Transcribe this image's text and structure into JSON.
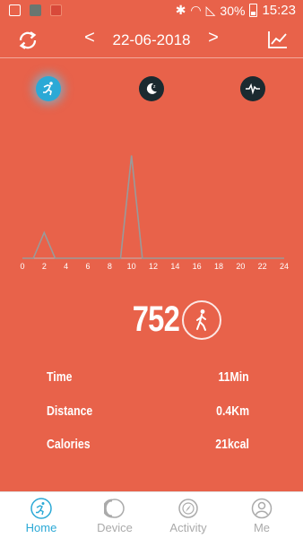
{
  "status_bar": {
    "battery": "30%",
    "time": "15:23"
  },
  "header": {
    "date": "22-06-2018",
    "prev_label": "<",
    "next_label": ">"
  },
  "modes": [
    {
      "name": "activity",
      "icon": "running-icon",
      "active": true
    },
    {
      "name": "sleep",
      "icon": "moon-icon",
      "active": false
    },
    {
      "name": "heart-rate",
      "icon": "heartbeat-icon",
      "active": false
    }
  ],
  "chart_data": {
    "type": "line",
    "x": [
      0,
      1,
      2,
      3,
      4,
      5,
      6,
      7,
      8,
      9,
      10,
      11,
      12,
      13,
      14,
      15,
      16,
      17,
      18,
      19,
      20,
      21,
      22,
      23,
      24
    ],
    "values": [
      0,
      0,
      150,
      0,
      0,
      0,
      0,
      0,
      0,
      0,
      600,
      0,
      0,
      0,
      0,
      0,
      0,
      0,
      0,
      0,
      0,
      0,
      0,
      0,
      0
    ],
    "x_ticks": [
      "0",
      "2",
      "4",
      "6",
      "8",
      "10",
      "12",
      "14",
      "16",
      "18",
      "20",
      "22",
      "24"
    ],
    "xlim": [
      0,
      24
    ],
    "ylim": [
      0,
      650
    ],
    "line_color": "#9a9a9a"
  },
  "summary": {
    "steps": "752",
    "steps_icon": "walking-icon"
  },
  "stats": [
    {
      "label": "Time",
      "value": "11Min"
    },
    {
      "label": "Distance",
      "value": "0.4Km"
    },
    {
      "label": "Calories",
      "value": "21kcal"
    }
  ],
  "tabs": [
    {
      "label": "Home",
      "icon": "running-icon",
      "active": true
    },
    {
      "label": "Device",
      "icon": "watch-icon",
      "active": false
    },
    {
      "label": "Activity",
      "icon": "compass-icon",
      "active": false
    },
    {
      "label": "Me",
      "icon": "user-icon",
      "active": false
    }
  ],
  "colors": {
    "background": "#E8624A",
    "accent": "#2BA9D6",
    "dark_icon": "#1B2A30",
    "tab_inactive": "#AAAAAA"
  }
}
